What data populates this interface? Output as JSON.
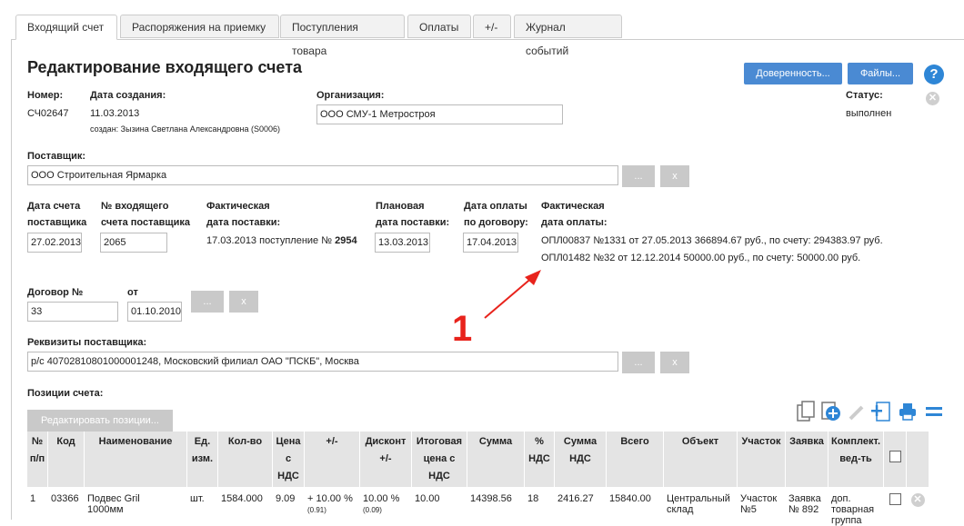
{
  "tabs": [
    "Входящий счет",
    "Распоряжения на приемку",
    "Поступления товара",
    "Оплаты",
    "+/-",
    "Журнал событий"
  ],
  "page": {
    "title": "Редактирование входящего счета",
    "btn_proxy": "Доверенность...",
    "btn_files": "Файлы...",
    "help": "?"
  },
  "header": {
    "number_label": "Номер:",
    "number": "СЧ02647",
    "created_label": "Дата создания:",
    "created": "11.03.2013",
    "created_by": "создан: Зызина Светлана Александровна (S0006)",
    "org_label": "Организация:",
    "org": "ООО СМУ-1 Метростроя",
    "status_label": "Статус:",
    "status": "выполнен"
  },
  "supplier": {
    "label": "Поставщик:",
    "value": "ООО Строительная Ярмарка",
    "btn_dots": "...",
    "btn_x": "x"
  },
  "dates": {
    "inv_date_l1": "Дата счета",
    "inv_date_l2": "поставщика",
    "inv_date": "27.02.2013",
    "inv_num_l1": "№ входящего",
    "inv_num_l2": "счета поставщика",
    "inv_num": "2065",
    "fact_del_l1": "Фактическая",
    "fact_del_l2": "дата поставки:",
    "fact_del_text": "17.03.2013 поступление №",
    "fact_del_num": "2954",
    "plan_del_l1": "Плановая",
    "plan_del_l2": "дата поставки:",
    "plan_del": "13.03.2013",
    "pay_due_l1": "Дата оплаты",
    "pay_due_l2": "по договору:",
    "pay_due": "17.04.2013",
    "fact_pay_l1": "Фактическая",
    "fact_pay_l2": "дата оплаты:",
    "payments": [
      "ОПЛ00837 №1331 от 27.05.2013 366894.67 руб., по счету: 294383.97 руб.",
      "ОПЛ01482 №32 от 12.12.2014 50000.00 руб., по счету: 50000.00 руб."
    ]
  },
  "contract": {
    "label": "Договор №",
    "number": "33",
    "from_label": "от",
    "date": "01.10.2010",
    "btn_dots": "...",
    "btn_x": "x"
  },
  "annotation": {
    "number": "1",
    "color": "#e8231c"
  },
  "requisites": {
    "label": "Реквизиты поставщика:",
    "value": "р/с 40702810801000001248, Московский филиал ОАО \"ПСКБ\", Москва",
    "btn_dots": "...",
    "btn_x": "x"
  },
  "positions": {
    "label": "Позиции счета:",
    "btn_edit": "Редактировать позиции..."
  },
  "table": {
    "headers": [
      [
        "№",
        "п/п"
      ],
      [
        "Код"
      ],
      [
        "Наименование"
      ],
      [
        "Ед.",
        "изм."
      ],
      [
        "Кол-во"
      ],
      [
        "Цена",
        "с",
        "НДС"
      ],
      [
        "+/-"
      ],
      [
        "Дисконт",
        "+/-"
      ],
      [
        "Итоговая",
        "цена с",
        "НДС"
      ],
      [
        "Сумма"
      ],
      [
        "%",
        "НДС"
      ],
      [
        "Сумма",
        "НДС"
      ],
      [
        "Всего"
      ],
      [
        "Объект"
      ],
      [
        "Участок"
      ],
      [
        "Заявка"
      ],
      [
        "Комплект.",
        "вед-ть"
      ]
    ],
    "row": {
      "n": "1",
      "code": "03366",
      "name_l1": "Подвес Gril",
      "name_l2": "1000мм",
      "unit": "шт.",
      "qty": "1584.000",
      "price": "9.09",
      "pm": "+ 10.00 %",
      "pm_sub": "(0.91)",
      "disc": "10.00 %",
      "disc_sub": "(0.09)",
      "final": "10.00",
      "sum": "14398.56",
      "vat_pct": "18",
      "vat_sum": "2416.27",
      "total": "15840.00",
      "obj_l1": "Центральный",
      "obj_l2": "склад",
      "site_l1": "Участок",
      "site_l2": "№5",
      "req_l1": "Заявка",
      "req_l2": "№ 892",
      "kit_l1": "доп.",
      "kit_l2": "товарная",
      "kit_l3": "группа"
    }
  },
  "colors": {
    "accent": "#4a8ad3",
    "icon": "#2e86d6",
    "header_bg": "#e4e4e4"
  }
}
